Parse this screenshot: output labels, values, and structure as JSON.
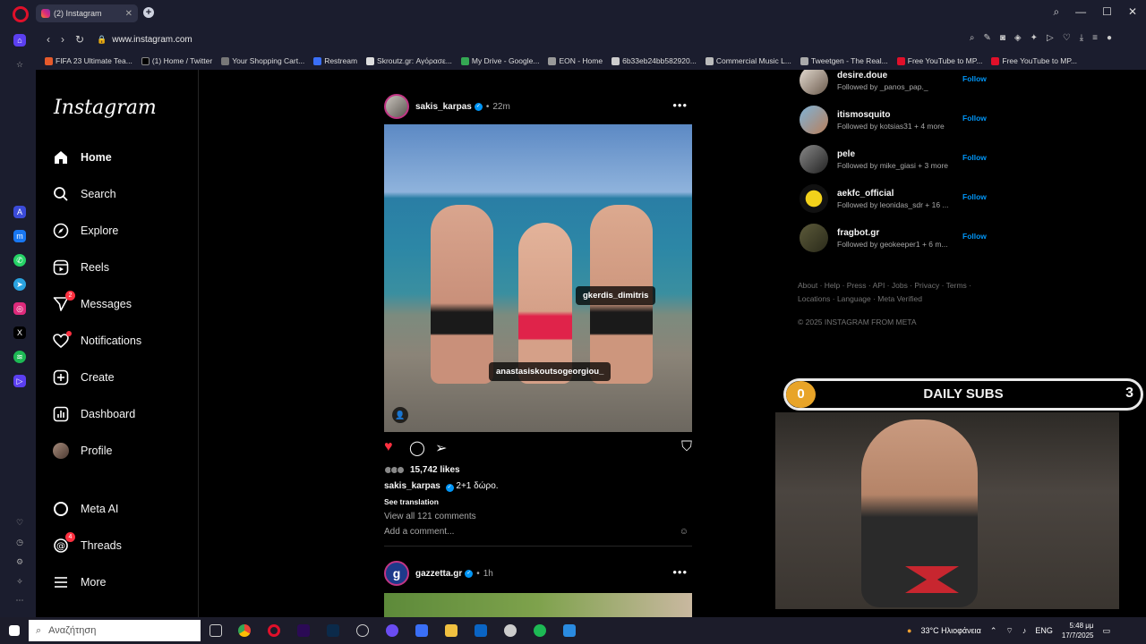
{
  "browser": {
    "tab_title": "(2) Instagram",
    "url": "www.instagram.com",
    "bookmarks": [
      "FIFA 23 Ultimate Tea...",
      "(1) Home / Twitter",
      "Your Shopping Cart...",
      "Restream",
      "Skroutz.gr: Αγόρασε...",
      "My Drive - Google...",
      "EON - Home",
      "6b33eb24bb582920...",
      "Commercial Music L...",
      "Tweetgen - The Real...",
      "Free YouTube to MP...",
      "Free YouTube to MP..."
    ]
  },
  "instagram": {
    "logo": "Instagram",
    "nav": [
      {
        "label": "Home"
      },
      {
        "label": "Search"
      },
      {
        "label": "Explore"
      },
      {
        "label": "Reels"
      },
      {
        "label": "Messages",
        "badge": "2"
      },
      {
        "label": "Notifications"
      },
      {
        "label": "Create"
      },
      {
        "label": "Dashboard"
      },
      {
        "label": "Profile"
      },
      {
        "label": "Meta AI"
      },
      {
        "label": "Threads",
        "badge": "4"
      },
      {
        "label": "More"
      }
    ],
    "post": {
      "username": "sakis_karpas",
      "time": "22m",
      "tags": [
        "gkerdis_dimitris",
        "anastasiskoutsogeorgiou_"
      ],
      "likes": "15,742 likes",
      "caption_user": "sakis_karpas",
      "caption_text": "2+1 δώρο.",
      "see_translation": "See translation",
      "view_comments": "View all 121 comments",
      "add_comment_placeholder": "Add a comment..."
    },
    "post2": {
      "username": "gazzetta.gr",
      "time": "1h",
      "avatar_letter": "g"
    },
    "suggestions": [
      {
        "name": "desire.doue",
        "sub": "Followed by _panos_pap._",
        "action": "Follow"
      },
      {
        "name": "itismosquito",
        "sub": "Followed by kotsias31 + 4 more",
        "action": "Follow"
      },
      {
        "name": "pele",
        "sub": "Followed by mike_giasi + 3 more",
        "action": "Follow"
      },
      {
        "name": "aekfc_official",
        "sub": "Followed by leonidas_sdr + 16 ...",
        "action": "Follow"
      },
      {
        "name": "fragbot.gr",
        "sub": "Followed by geokeeper1 + 6 m...",
        "action": "Follow"
      }
    ],
    "footer_line1": "About · Help · Press · API · Jobs · Privacy · Terms ·",
    "footer_line2": "Locations · Language · Meta Verified",
    "copyright": "© 2025 INSTAGRAM FROM META"
  },
  "overlay": {
    "subs_left": "0",
    "subs_title": "DAILY SUBS",
    "subs_right": "3"
  },
  "taskbar": {
    "search_placeholder": "Αναζήτηση",
    "weather": "33°C Ηλιοφάνεια",
    "lang": "ENG",
    "time": "5:48 μμ",
    "date": "17/7/2025"
  }
}
